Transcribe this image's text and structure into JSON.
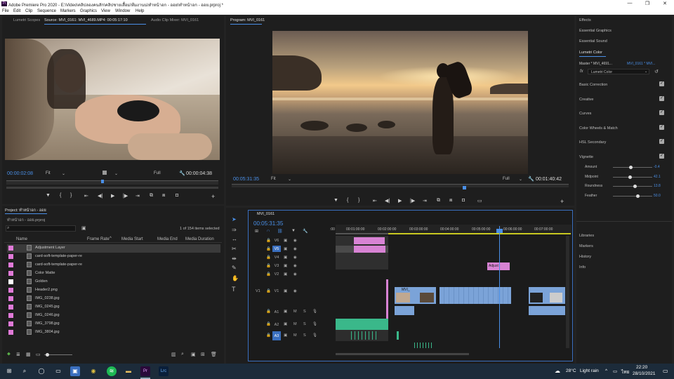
{
  "window": {
    "title": "Adobe Premiere Pro 2020 - E:\\Video\\คลิปลองคนสัก\\คลิปชายเสื้อม\\ทีมงานน\\ทำหน้าอก - ออย\\ทำหน้าอก - ออย.prproj *",
    "minimize": "—",
    "maximize": "❐",
    "close": "✕"
  },
  "menu": [
    "File",
    "Edit",
    "Clip",
    "Sequence",
    "Markers",
    "Graphics",
    "View",
    "Window",
    "Help"
  ],
  "source_panel": {
    "tabs": [
      "Lumetri Scopes",
      "Source: MVI_0161: MVI_4689.MP4: 00:05:17:10",
      "Audio Clip Mixer: MVI_0161"
    ],
    "timecode": "00:00:02:08",
    "fit": "Fit",
    "quality": "Full",
    "duration": "00:00:04:38"
  },
  "program_panel": {
    "tab": "Program: MVI_0161",
    "timecode": "00:05:31:35",
    "fit": "Fit",
    "quality": "Full",
    "duration": "00:01:40:42"
  },
  "project_panel": {
    "tab": "Project: ทำหน้าอก - ออย",
    "path": "ทำหน้าอก - ออย.prproj",
    "items_count": "1 of 154 items selected",
    "columns": [
      "Name",
      "Frame Rate",
      "Media Start",
      "Media End",
      "Media Duration"
    ],
    "items": [
      {
        "name": "Adjustment Layer",
        "color": "#e07ad8"
      },
      {
        "name": "card-soft-template-paper-re",
        "color": "#e07ad8"
      },
      {
        "name": "card-soft-template-paper-re",
        "color": "#e07ad8"
      },
      {
        "name": "Color Matte",
        "color": "#e07ad8"
      },
      {
        "name": "Golden",
        "color": "#ffffff"
      },
      {
        "name": "Header2.png",
        "color": "#e07ad8"
      },
      {
        "name": "IMG_0238.jpg",
        "color": "#e07ad8"
      },
      {
        "name": "IMG_0245.jpg",
        "color": "#e07ad8"
      },
      {
        "name": "IMG_0246.jpg",
        "color": "#e07ad8"
      },
      {
        "name": "IMG_3798.jpg",
        "color": "#e07ad8"
      },
      {
        "name": "IMG_3804.jpg",
        "color": "#e07ad8"
      }
    ]
  },
  "timeline": {
    "tab": "MVI_0161",
    "timecode": "00:05:31:35",
    "ruler": [
      "00:01:00:00",
      "00:02:00:00",
      "00:03:00:00",
      "00:04:00:00",
      "00:05:00:00",
      "00:06:00:00",
      "00:07:00:00"
    ],
    "video_tracks": [
      "V6",
      "V5",
      "V4",
      "V3",
      "V2",
      "V1"
    ],
    "audio_tracks": [
      "A1",
      "A2",
      "A3"
    ],
    "adjust_label": "Adjust",
    "clip_label": "MVI_",
    "v1_label": "V1"
  },
  "right_panel": {
    "items": [
      "Effects",
      "Essential Graphics",
      "Essential Sound"
    ],
    "lumetri_title": "Lumetri Color",
    "master": "Master * MVI_4691...",
    "master_link": "MVI_0161 * MVI...",
    "fx_label": "fx",
    "fx_select": "Lumetri Color",
    "sections": [
      "Basic Correction",
      "Creative",
      "Curves",
      "Color Wheels & Match",
      "HSL Secondary",
      "Vignette"
    ],
    "vignette": [
      {
        "label": "Amount",
        "value": "-0.4",
        "pos": 0.45
      },
      {
        "label": "Midpoint",
        "value": "42.1",
        "pos": 0.42
      },
      {
        "label": "Roundness",
        "value": "13.8",
        "pos": 0.55
      },
      {
        "label": "Feather",
        "value": "50.0",
        "pos": 0.62
      }
    ],
    "bottom_items": [
      "Libraries",
      "Markers",
      "History",
      "Info"
    ]
  },
  "taskbar": {
    "weather": "28°C",
    "weather_text": "Light rain",
    "lang": "ไทย",
    "time": "22:20",
    "date": "28/10/2021"
  },
  "colors": {
    "accent": "#4a8fe7",
    "pink": "#e07ad8",
    "clip_blue": "#7ba3d8",
    "audio_green": "#3ab88a"
  }
}
